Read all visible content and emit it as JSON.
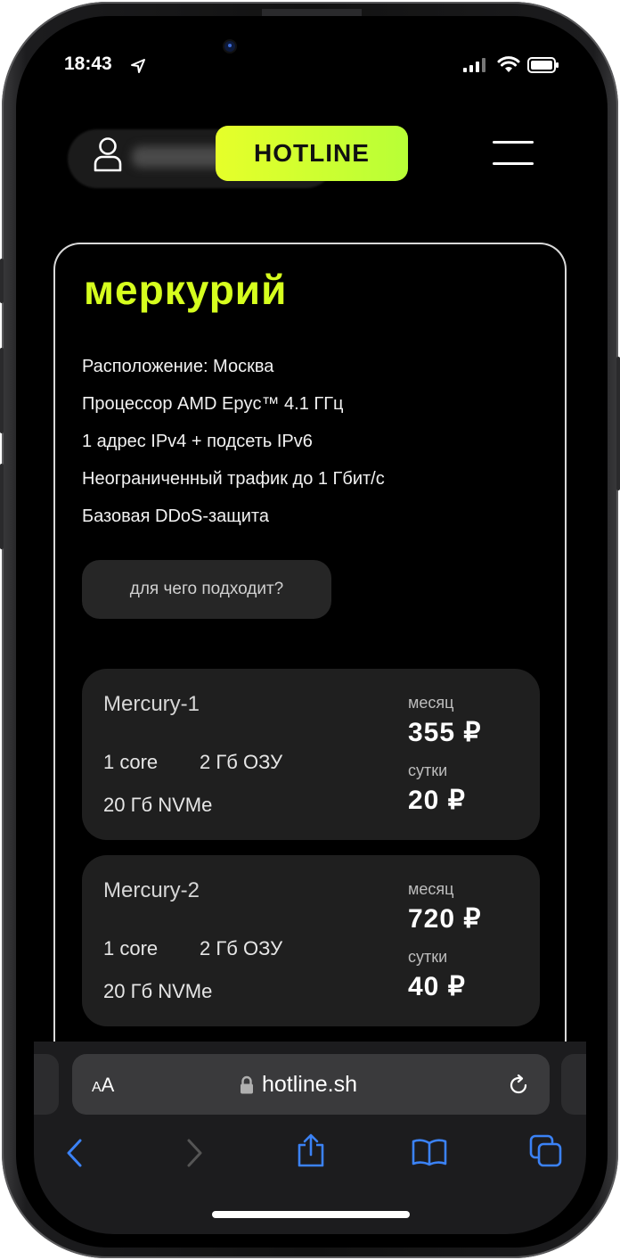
{
  "status_bar": {
    "time": "18:43",
    "icons": [
      "location-arrow-icon",
      "cellular-signal-icon",
      "wifi-icon",
      "battery-icon"
    ]
  },
  "header": {
    "brand": "HOTLINE",
    "brand_color": "#d6ff1e",
    "icons": [
      "user-icon",
      "hamburger-menu-icon"
    ]
  },
  "plan": {
    "title": "меркурий",
    "features": [
      "Расположение: Москва",
      "Процессор AMD Epyc™ 4.1 ГГц",
      "1 адрес IPv4 + подсеть IPv6",
      "Неограниченный трафик до 1 Гбит/с",
      "Базовая DDoS-защита"
    ],
    "usecase_button": "для чего подходит?",
    "tariffs": [
      {
        "name": "Mercury-1",
        "cores": "1 core",
        "ram": "2 Гб ОЗУ",
        "disk": "20 Гб NVMe",
        "month_label": "месяц",
        "month_price": "355 ₽",
        "day_label": "сутки",
        "day_price": "20 ₽"
      },
      {
        "name": "Mercury-2",
        "cores": "1 core",
        "ram": "2 Гб ОЗУ",
        "disk": "20 Гб NVMe",
        "month_label": "месяц",
        "month_price": "720 ₽",
        "day_label": "сутки",
        "day_price": "40 ₽"
      }
    ]
  },
  "browser": {
    "text_size_small": "A",
    "text_size_large": "A",
    "url": "hotline.sh",
    "accent_color": "#3b82f6",
    "icons": [
      "lock-icon",
      "reload-icon",
      "back-icon",
      "forward-icon",
      "share-icon",
      "bookmarks-icon",
      "tabs-icon"
    ]
  }
}
